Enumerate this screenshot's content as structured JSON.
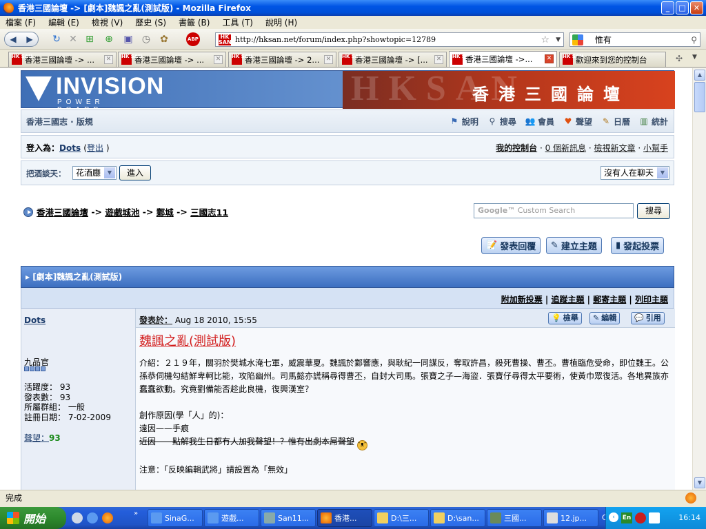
{
  "window": {
    "title": "香港三國論壇 -> [劇本]魏諷之亂(測試版) - Mozilla Firefox",
    "buttons": {
      "minimize": "_",
      "maximize": "□",
      "close": "✕"
    }
  },
  "menu": [
    "檔案 (F)",
    "編輯 (E)",
    "檢視 (V)",
    "歷史 (S)",
    "書籤 (B)",
    "工具 (T)",
    "說明 (H)"
  ],
  "navbar": {
    "url": "http://hksan.net/forum/index.php?showtopic=12789",
    "search_value": "惟有"
  },
  "tabs": [
    {
      "label": "香港三國論壇 -> ...",
      "active": false
    },
    {
      "label": "香港三國論壇 -> ...",
      "active": false
    },
    {
      "label": "香港三國論壇 -> 2...",
      "active": false
    },
    {
      "label": "香港三國論壇 -> [...",
      "active": false
    },
    {
      "label": "香港三國論壇 ->...",
      "active": true
    },
    {
      "label": "歡迎來到您的控制台",
      "active": false
    }
  ],
  "banner": {
    "logo": "INVISION",
    "logo_sub": "POWER BOARD",
    "title": "香港三國論壇"
  },
  "forum_nav": {
    "site_name": "香港三國志 · 版規",
    "links": [
      {
        "label": "說明",
        "icon": "help-icon"
      },
      {
        "label": "搜尋",
        "icon": "search-icon"
      },
      {
        "label": "會員",
        "icon": "members-icon"
      },
      {
        "label": "聲望",
        "icon": "heart-icon"
      },
      {
        "label": "日曆",
        "icon": "calendar-icon"
      },
      {
        "label": "統計",
        "icon": "stats-icon"
      }
    ]
  },
  "userbar": {
    "logged_in_prefix": "登入為：",
    "username": "Dots",
    "logout": "登出",
    "my_controls": "我的控制台",
    "new_messages": "0 個新訊息",
    "view_new_posts": "檢視新文章",
    "assistant": "小幫手"
  },
  "chat": {
    "label": "把酒談天：",
    "room": "花酒廳",
    "enter": "進入",
    "status": "沒有人在聊天"
  },
  "breadcrumb": [
    "香港三國論壇",
    "遊戲城池",
    "鄴城",
    "三國志11"
  ],
  "google_search": {
    "placeholder": "Custom Search",
    "button": "搜尋"
  },
  "actions": {
    "reply": "發表回覆",
    "new_topic": "建立主題",
    "new_poll": "發起投票"
  },
  "topic": {
    "title": "[劇本]魏諷之亂(測試版)",
    "options": [
      "附加新投票",
      "追蹤主題",
      "郵寄主題",
      "列印主題"
    ]
  },
  "post": {
    "author": "Dots",
    "rank": "九品官",
    "pips": 4,
    "stats": [
      {
        "label": "活躍度：",
        "value": "93"
      },
      {
        "label": "發表數：",
        "value": "93"
      },
      {
        "label": "所屬群組：",
        "value": "一般"
      },
      {
        "label": "註冊日期：",
        "value": "7-02-2009"
      }
    ],
    "reputation_label": "聲望：",
    "reputation": "93",
    "date_label": "發表於：",
    "date": "Aug 18 2010, 15:55",
    "buttons": {
      "report": "檢舉",
      "edit": "編輯",
      "quote": "引用"
    },
    "title": "魏諷之亂(測試版)",
    "intro": "介紹：２１９年，關羽於樊城水淹七軍，威震華夏。魏諷於鄴響應，與耿紀一同謀反，奪取許昌，殺死曹操、曹丕。曹植臨危受命，即位魏王。公孫恭伺機勾結鮮卑軻比能，攻陷幽州。司馬懿亦謊稱尋得曹丕，自封大司馬。張寶之子—海盜．張寶仔尋得太平要術，使黃巾眾復活。各地異族亦蠢蠢欲動。究竟劉備能否趁此良機，復興漢室？",
    "reason_title": "創作原因(學「人」的)：",
    "far_reason": "遠因——手痕",
    "near_reason": "近因——點解我生日都冇人加我聲望！？惟有出劇本屌聲望",
    "note": "注意：「反映編輯武將」請設置為「無效」"
  },
  "status_text": "完成",
  "taskbar": {
    "start": "開始",
    "tasks": [
      {
        "label": "SinaG...",
        "active": false
      },
      {
        "label": "遊戲...",
        "active": false
      },
      {
        "label": "San11...",
        "active": false
      },
      {
        "label": "香港...",
        "active": true
      },
      {
        "label": "D:\\三...",
        "active": false
      },
      {
        "label": "D:\\san...",
        "active": false
      },
      {
        "label": "三國...",
        "active": false
      },
      {
        "label": "12.jp...",
        "active": false
      }
    ],
    "lang": "CH",
    "time": "16:14"
  },
  "colors": {
    "accent": "#3c6fc0",
    "title_red": "#d21c1c",
    "taskbar": "#245edb"
  }
}
